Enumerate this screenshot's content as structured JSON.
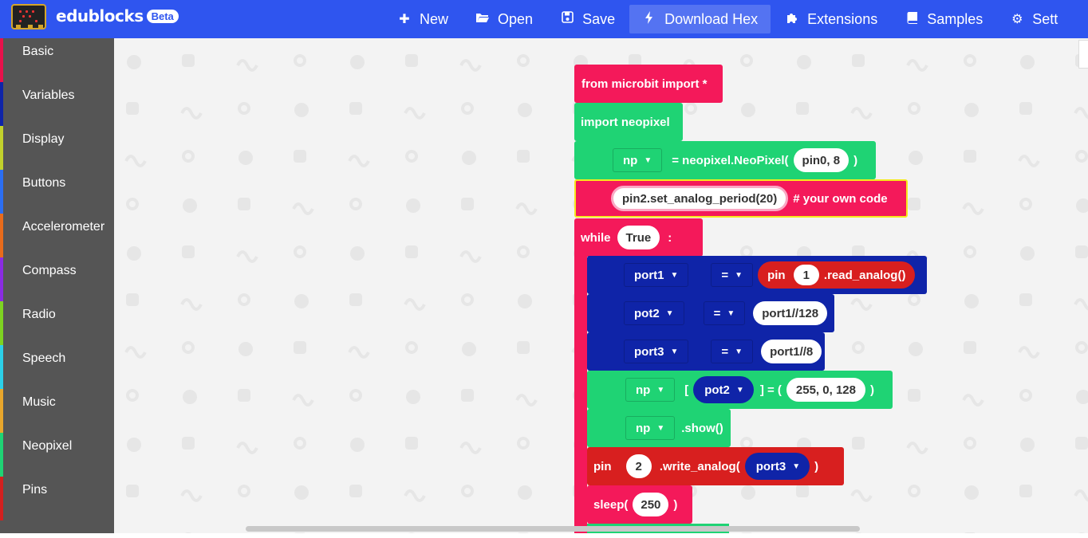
{
  "header": {
    "brand": "edublocks",
    "badge": "Beta",
    "nav": [
      {
        "label": "New",
        "icon": "plus-icon"
      },
      {
        "label": "Open",
        "icon": "folder-open-icon"
      },
      {
        "label": "Save",
        "icon": "floppy-disk-icon"
      },
      {
        "label": "Download Hex",
        "icon": "bolt-icon",
        "active": true
      },
      {
        "label": "Extensions",
        "icon": "puzzle-icon"
      },
      {
        "label": "Samples",
        "icon": "book-icon"
      },
      {
        "label": "Sett",
        "icon": "gear-icon"
      }
    ]
  },
  "sidebar": {
    "items": [
      {
        "label": "Basic",
        "color": "#e8114b"
      },
      {
        "label": "Variables",
        "color": "#0f24a8"
      },
      {
        "label": "Display",
        "color": "#c1d12b"
      },
      {
        "label": "Buttons",
        "color": "#2b6ef2"
      },
      {
        "label": "Accelerometer",
        "color": "#e86b1b"
      },
      {
        "label": "Compass",
        "color": "#8a2be2"
      },
      {
        "label": "Radio",
        "color": "#7ed321"
      },
      {
        "label": "Speech",
        "color": "#2bd0e8"
      },
      {
        "label": "Music",
        "color": "#e8a62b"
      },
      {
        "label": "Neopixel",
        "color": "#1fd374"
      },
      {
        "label": "Pins",
        "color": "#d3201f"
      }
    ]
  },
  "blocks": {
    "import_microbit": "from microbit import *",
    "import_neopixel": "import neopixel",
    "np_var": "np",
    "np_assign": "= neopixel.NeoPixel(",
    "np_args": "pin0, 8",
    "close_paren": ")",
    "own_code_value": "pin2.set_analog_period(20)",
    "own_code_label": "# your own code",
    "while_label": "while",
    "while_cond": "True",
    "colon": ":",
    "port1_var": "port1",
    "eq": "=",
    "pin_label": "pin",
    "pin1_num": "1",
    "read_analog": ".read_analog()",
    "pot2_var": "pot2",
    "pot2_value": "port1//128",
    "port3_var": "port3",
    "port3_value": "port1//8",
    "open_bracket": "[",
    "close_bracket_eq": "] = (",
    "rgb_value": "255, 0, 128",
    "show": ".show()",
    "pin2_num": "2",
    "write_analog": ".write_analog(",
    "sleep_label": "sleep(",
    "sleep_value": "250"
  },
  "colors": {
    "header": "#2f55ef",
    "basic": "#f4195a",
    "neopixel": "#1fd374",
    "variables": "#0f24a8",
    "pins": "#d81f1f"
  }
}
